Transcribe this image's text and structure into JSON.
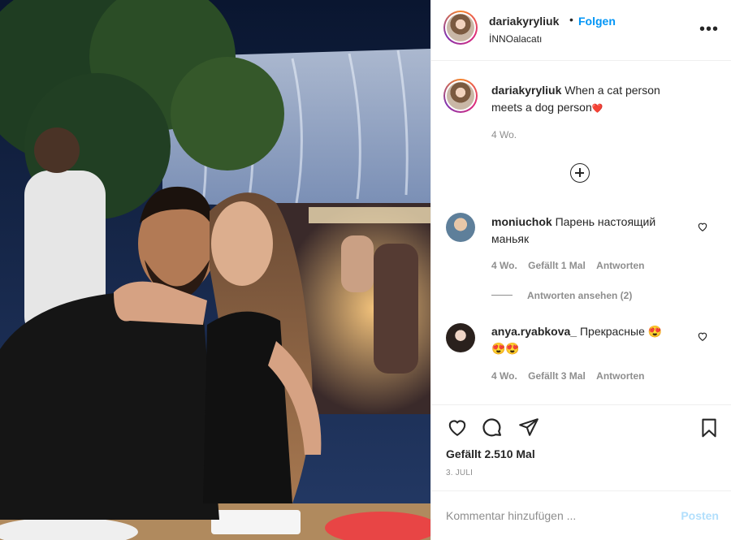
{
  "post": {
    "username": "dariakyryliuk",
    "follow_label": "Folgen",
    "separator": "•",
    "location": "İNNOalacatı",
    "more_label": "•••"
  },
  "caption": {
    "username": "dariakyryliuk",
    "line1": "When a cat person",
    "line2": "meets a dog person",
    "emoji": "❤️",
    "time": "4 Wo."
  },
  "comments": [
    {
      "username": "moniuchok",
      "text_line1": "Парень настоящий",
      "text_line2": "маньяк",
      "time": "4 Wo.",
      "likes": "Gefällt 1 Mal",
      "reply": "Antworten",
      "view_replies": "Antworten ansehen (2)"
    },
    {
      "username": "anya.ryabkova_",
      "text_line1": "Прекрасные 😍",
      "text_line2": "😍😍",
      "time": "4 Wo.",
      "likes": "Gefällt 3 Mal",
      "reply": "Antworten"
    }
  ],
  "actions": {
    "likes": "Gefällt 2.510 Mal",
    "date": "3. JULI"
  },
  "comment_box": {
    "placeholder": "Kommentar hinzufügen ...",
    "post_label": "Posten"
  },
  "icons": [
    "heart-icon",
    "comment-icon",
    "share-icon",
    "bookmark-icon",
    "plus-circle-icon",
    "more-icon"
  ]
}
